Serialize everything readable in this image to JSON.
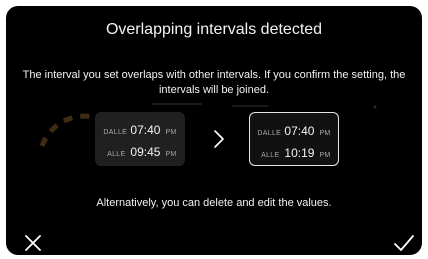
{
  "dialog": {
    "title": "Overlapping intervals detected",
    "message": "The interval you set overlaps with other intervals. If you confirm the setting, the intervals will be joined.",
    "alternative_text": "Alternatively, you can delete and edit the values."
  },
  "current_interval": {
    "from_label": "DALLE",
    "from_time": "07:40",
    "from_period": "PM",
    "to_label": "ALLE",
    "to_time": "09:45",
    "to_period": "PM"
  },
  "merged_interval": {
    "from_label": "DALLE",
    "from_time": "07:40",
    "from_period": "PM",
    "to_label": "ALLE",
    "to_time": "10:19",
    "to_period": "PM"
  },
  "icons": {
    "arrow": "chevron-right-icon",
    "cancel": "close-icon",
    "confirm": "checkmark-icon"
  },
  "colors": {
    "background": "#000000",
    "text": "#f2f2f2",
    "secondary_text": "#a8a8a8",
    "card_fill": "#202020",
    "card_border": "#e6e6e6",
    "ghost_accent": "#e6a23c"
  }
}
